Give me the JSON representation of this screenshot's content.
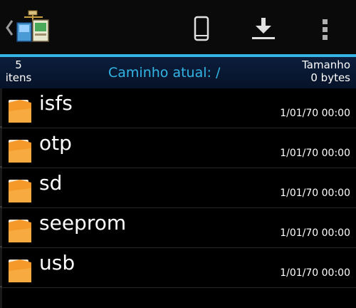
{
  "actionbar": {
    "icons": [
      "back-chevron-icon",
      "network-folders-logo-icon",
      "phone-icon",
      "download-icon",
      "overflow-menu-icon"
    ]
  },
  "infobar": {
    "count_number": "5",
    "count_unit": "itens",
    "path_label": "Caminho atual: /",
    "size_label": "Tamanho",
    "size_value": "0 bytes"
  },
  "files": [
    {
      "name": "isfs",
      "date": "1/01/70 00:00",
      "icon": "folder-icon"
    },
    {
      "name": "otp",
      "date": "1/01/70 00:00",
      "icon": "folder-icon"
    },
    {
      "name": "sd",
      "date": "1/01/70 00:00",
      "icon": "folder-icon"
    },
    {
      "name": "seeprom",
      "date": "1/01/70 00:00",
      "icon": "folder-icon"
    },
    {
      "name": "usb",
      "date": "1/01/70 00:00",
      "icon": "folder-icon"
    }
  ],
  "colors": {
    "accent": "#33b5e5",
    "folder_orange": "#f59a2a",
    "infobar_bg": "#0a1a36"
  }
}
